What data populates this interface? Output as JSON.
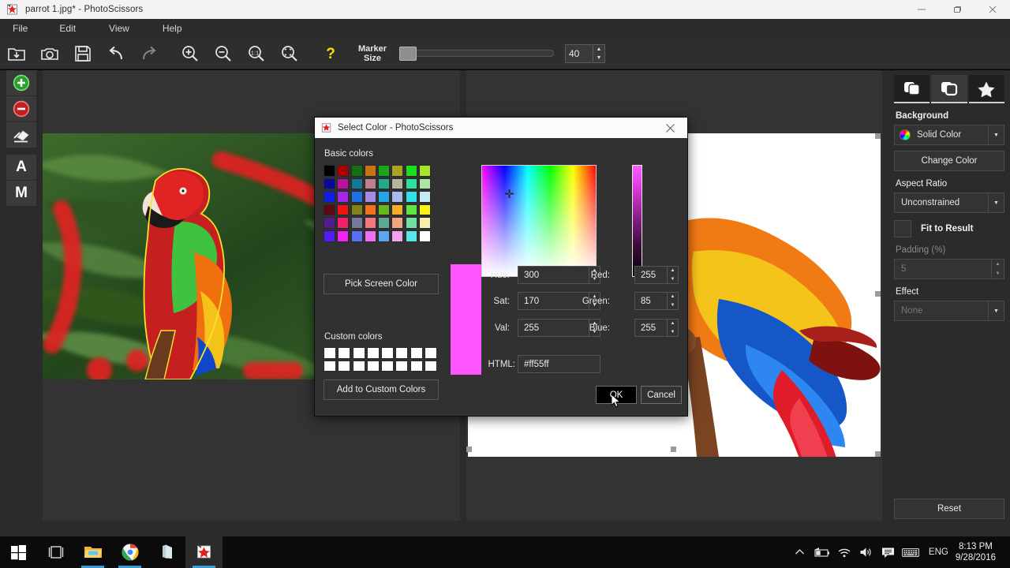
{
  "window": {
    "title": "parrot 1.jpg* - PhotoScissors",
    "icon": "app-icon",
    "buttons": {
      "minimize": "–",
      "maximize": "❐",
      "close": "✕"
    }
  },
  "menubar": {
    "items": [
      "File",
      "Edit",
      "View",
      "Help"
    ]
  },
  "toolbar": {
    "buttons": [
      {
        "name": "open-file-icon",
        "title": "Open"
      },
      {
        "name": "camera-icon",
        "title": "Capture"
      },
      {
        "name": "save-icon",
        "title": "Save"
      },
      {
        "name": "undo-icon",
        "title": "Undo"
      },
      {
        "name": "redo-icon",
        "title": "Redo"
      },
      {
        "name": "zoom-in-icon",
        "title": "Zoom In"
      },
      {
        "name": "zoom-out-icon",
        "title": "Zoom Out"
      },
      {
        "name": "zoom-actual-icon",
        "title": "1:1"
      },
      {
        "name": "zoom-fit-icon",
        "title": "Fit"
      },
      {
        "name": "help-icon",
        "title": "Help"
      }
    ],
    "marker_size_label_line1": "Marker",
    "marker_size_label_line2": "Size",
    "marker_size_value": "40"
  },
  "left_rail": {
    "tools": [
      {
        "name": "add-foreground-tool",
        "label": "+"
      },
      {
        "name": "remove-background-tool",
        "label": "–"
      },
      {
        "name": "eraser-tool",
        "label": "eraser"
      },
      {
        "name": "auto-tool",
        "label": "A"
      },
      {
        "name": "manual-tool",
        "label": "M"
      }
    ]
  },
  "right_panel": {
    "tabs": [
      {
        "name": "tab-foreground",
        "icon": "layers-filled-icon"
      },
      {
        "name": "tab-background",
        "icon": "layers-outline-icon"
      },
      {
        "name": "tab-effects",
        "icon": "star-icon"
      }
    ],
    "background_label": "Background",
    "background_value": "Solid Color",
    "change_color_label": "Change Color",
    "aspect_ratio_label": "Aspect Ratio",
    "aspect_ratio_value": "Unconstrained",
    "fit_to_result_label": "Fit to Result",
    "fit_to_result_checked": false,
    "padding_label": "Padding (%)",
    "padding_value": "5",
    "effect_label": "Effect",
    "effect_value": "None",
    "reset_label": "Reset"
  },
  "dialog": {
    "title": "Select Color - PhotoScissors",
    "close_glyph": "✕",
    "basic_colors_label": "Basic colors",
    "basic_colors": [
      [
        "#000000",
        "#aa0000",
        "#127112",
        "#c87410",
        "#1ba51b",
        "#a8a323",
        "#19e019",
        "#a5e52b"
      ],
      [
        "#0a0a99",
        "#bb11a0",
        "#147a9c",
        "#c07f8c",
        "#20ab8a",
        "#b8b49b",
        "#2fe0a0",
        "#abe7a3"
      ],
      [
        "#0f1fe8",
        "#a426e8",
        "#1e72e8",
        "#a78ae8",
        "#23a6e8",
        "#adb8ef",
        "#2ce2e8",
        "#c4eaf2"
      ],
      [
        "#5a0a11",
        "#f01414",
        "#83811a",
        "#f2721a",
        "#66b81f",
        "#f5ae27",
        "#5ce640",
        "#f7f410"
      ],
      [
        "#541a8f",
        "#f51f6e",
        "#757a9d",
        "#f4767e",
        "#5fa897",
        "#f4a482",
        "#6fe0a2",
        "#f7eeae"
      ],
      [
        "#521cf5",
        "#f521f5",
        "#5a6ff5",
        "#f06ef0",
        "#5aa7f0",
        "#f0a3ee",
        "#56e8e8",
        "#ffffff"
      ]
    ],
    "pick_screen_color_label": "Pick Screen Color",
    "custom_colors_label": "Custom colors",
    "custom_colors_rows": 2,
    "custom_colors_cols": 8,
    "custom_color_fill": "#ffffff",
    "fields": [
      {
        "name": "hue-field",
        "label": "Hue:",
        "value": "300"
      },
      {
        "name": "sat-field",
        "label": "Sat:",
        "value": "170"
      },
      {
        "name": "val-field",
        "label": "Val:",
        "value": "255"
      },
      {
        "name": "red-field",
        "label": "Red:",
        "value": "255"
      },
      {
        "name": "green-field",
        "label": "Green:",
        "value": "85"
      },
      {
        "name": "blue-field",
        "label": "Blue:",
        "value": "255"
      }
    ],
    "html_label": "HTML:",
    "html_value": "#ff55ff",
    "preview_color": "#ff55ff",
    "ok_label": "OK",
    "cancel_label": "Cancel"
  },
  "taskbar": {
    "items": [
      {
        "name": "start-button",
        "icon": "windows-logo-icon"
      },
      {
        "name": "task-view-button",
        "icon": "task-view-icon"
      },
      {
        "name": "file-explorer-button",
        "icon": "folder-icon"
      },
      {
        "name": "chrome-button",
        "icon": "chrome-icon"
      },
      {
        "name": "store-button",
        "icon": "store-icon"
      },
      {
        "name": "photoscissors-button",
        "icon": "photoscissors-icon"
      }
    ],
    "tray": [
      {
        "name": "show-hidden-icons",
        "glyph": "∧"
      },
      {
        "name": "battery-icon",
        "glyph": "battery"
      },
      {
        "name": "wifi-icon",
        "glyph": "wifi"
      },
      {
        "name": "volume-icon",
        "glyph": "volume"
      },
      {
        "name": "action-center-icon",
        "glyph": "message"
      },
      {
        "name": "keyboard-icon",
        "glyph": "keyboard"
      }
    ],
    "language": "ENG",
    "time": "8:13 PM",
    "date": "9/28/2016"
  }
}
